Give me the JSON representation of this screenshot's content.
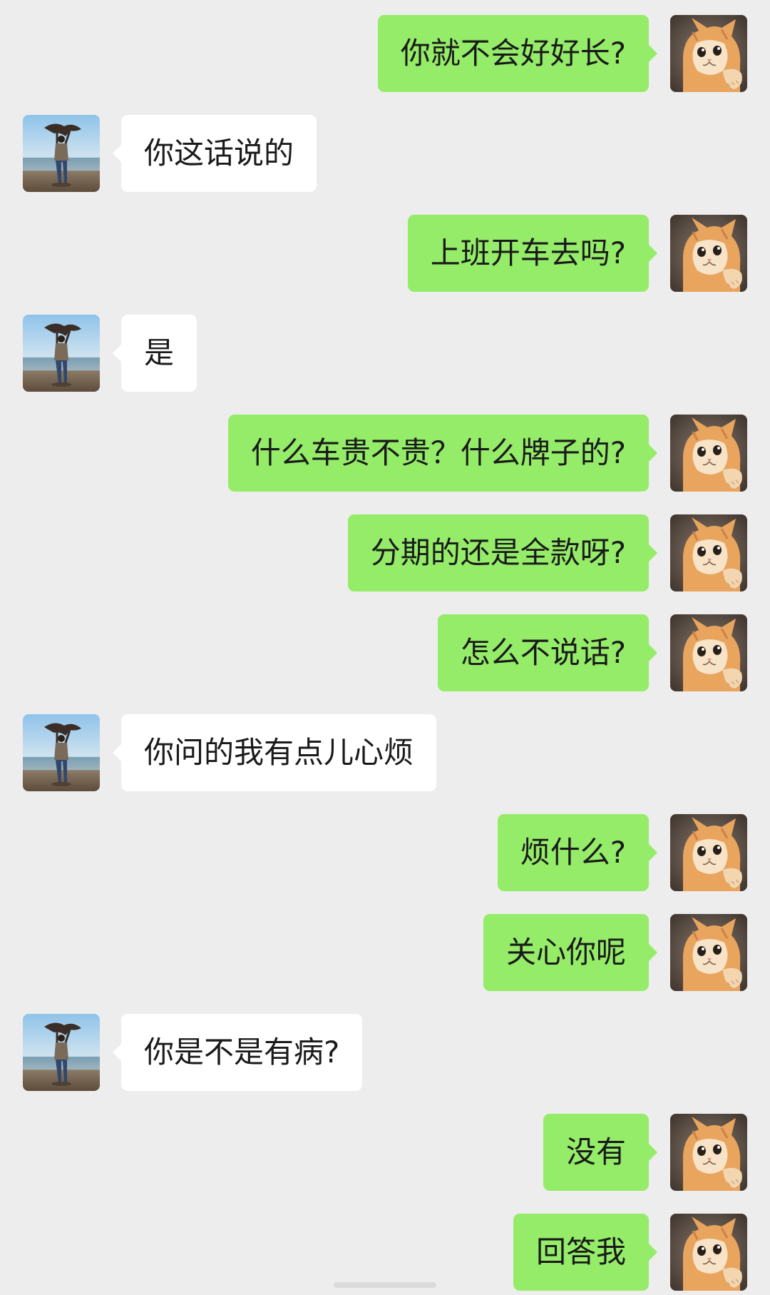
{
  "colors": {
    "background": "#ededed",
    "incoming_bubble": "#ffffff",
    "outgoing_bubble": "#95ec69",
    "text": "#1a1a1a"
  },
  "avatars": {
    "self": "cat-avatar-icon",
    "contact": "person-on-beach-avatar-icon"
  },
  "messages": [
    {
      "sender": "self",
      "text": "你就不会好好长?"
    },
    {
      "sender": "contact",
      "text": "你这话说的"
    },
    {
      "sender": "self",
      "text": "上班开车去吗?"
    },
    {
      "sender": "contact",
      "text": "是"
    },
    {
      "sender": "self",
      "text": "什么车贵不贵？什么牌子的?"
    },
    {
      "sender": "self",
      "text": "分期的还是全款呀?"
    },
    {
      "sender": "self",
      "text": "怎么不说话?"
    },
    {
      "sender": "contact",
      "text": "你问的我有点儿心烦"
    },
    {
      "sender": "self",
      "text": "烦什么?"
    },
    {
      "sender": "self",
      "text": "关心你呢"
    },
    {
      "sender": "contact",
      "text": "你是不是有病?"
    },
    {
      "sender": "self",
      "text": "没有"
    },
    {
      "sender": "self",
      "text": "回答我"
    }
  ]
}
